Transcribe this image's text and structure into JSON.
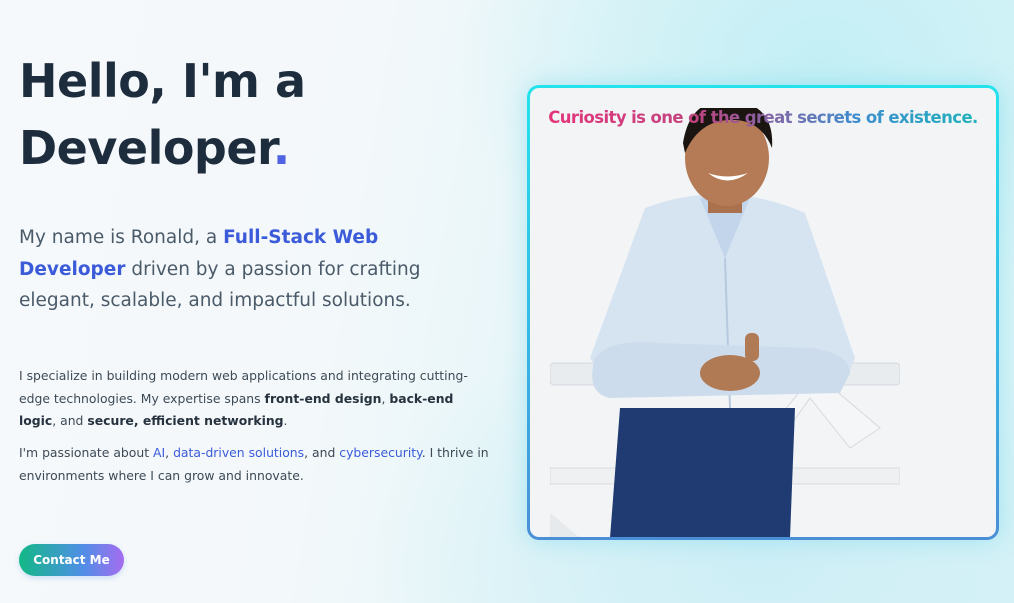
{
  "hero": {
    "line1": "Hello, I'm a",
    "line2": "Developer",
    "dot": "."
  },
  "intro": {
    "prefix": "My name is Ronald, a ",
    "role": "Full-Stack Web Developer",
    "suffix": "driven by a passion for crafting elegant, scalable, and impactful solutions."
  },
  "paragraph1": {
    "t1": "I specialize in building modern web applications and integrating cutting-edge technologies. My expertise spans ",
    "b1": "front-end design",
    "t2": ", ",
    "b2": "back-end logic",
    "t3": ", and ",
    "b3": "secure, efficient networking",
    "t4": "."
  },
  "paragraph2": {
    "t1": "I'm passionate about ",
    "l1": "AI",
    "t2": ", ",
    "l2": "data-driven solutions",
    "t3": ", and ",
    "l3": "cybersecurity",
    "t4": ". I thrive in environments where I can grow and innovate."
  },
  "contact_button": "Contact Me",
  "quote": "Curiosity is one of the great secrets of existence.",
  "colors": {
    "accent": "#3b5bd9",
    "heading": "#1e2d3d",
    "frame_border": "#22e3ec",
    "button_gradient": [
      "#12b886",
      "#4f8fe6",
      "#a56cf0"
    ]
  }
}
